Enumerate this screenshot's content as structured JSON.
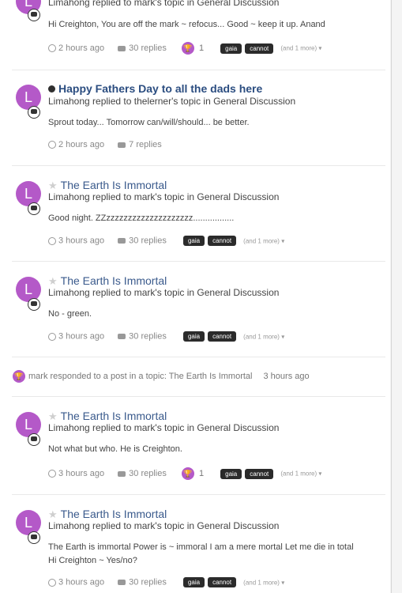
{
  "feed": {
    "item1": {
      "avatar_letter": "L",
      "subtitle": "Limahong replied to mark's topic in General Discussion",
      "body": "Hi Creighton, You are off the mark ~ refocus... Good ~ keep it up. Anand",
      "time": "2 hours ago",
      "replies": "30 replies",
      "trophy_count": "1",
      "tags": [
        "gaia",
        "cannot"
      ],
      "more": "(and 1 more)"
    },
    "item2": {
      "avatar_letter": "L",
      "title": "Happy Fathers Day to all the dads here",
      "subtitle": "Limahong replied to thelerner's topic in General Discussion",
      "body": "Sprout today... Tomorrow can/will/should... be better.",
      "time": "2 hours ago",
      "replies": "7 replies"
    },
    "item3": {
      "avatar_letter": "L",
      "title": "The Earth Is Immortal",
      "subtitle": "Limahong replied to mark's topic in General Discussion",
      "body": "Good night. ZZzzzzzzzzzzzzzzzzzzzz.................",
      "time": "3 hours ago",
      "replies": "30 replies",
      "tags": [
        "gaia",
        "cannot"
      ],
      "more": "(and 1 more)"
    },
    "item4": {
      "avatar_letter": "L",
      "title": "The Earth Is Immortal",
      "subtitle": "Limahong replied to mark's topic in General Discussion",
      "body": "No - green.",
      "time": "3 hours ago",
      "replies": "30 replies",
      "tags": [
        "gaia",
        "cannot"
      ],
      "more": "(and 1 more)"
    },
    "activity": {
      "text": "mark responded to a post in a topic: The Earth Is Immortal",
      "time": "3 hours ago"
    },
    "item5": {
      "avatar_letter": "L",
      "title": "The Earth Is Immortal",
      "subtitle": "Limahong replied to mark's topic in General Discussion",
      "body": "Not what but who. He is Creighton.",
      "time": "3 hours ago",
      "replies": "30 replies",
      "trophy_count": "1",
      "tags": [
        "gaia",
        "cannot"
      ],
      "more": "(and 1 more)"
    },
    "item6": {
      "avatar_letter": "L",
      "title": "The Earth Is Immortal",
      "subtitle": "Limahong replied to mark's topic in General Discussion",
      "body": "The Earth is immortal Power is ~ immoral I am a mere mortal Let me die in total Hi Creighton ~ Yes/no?",
      "time": "3 hours ago",
      "replies": "30 replies",
      "tags": [
        "gaia",
        "cannot"
      ],
      "more": "(and 1 more)"
    }
  },
  "colors": {
    "avatar": "#b459c8",
    "link": "#3a5a8c",
    "tag_bg": "#2b2b2b"
  },
  "icons": [
    "clock-icon",
    "comment-icon",
    "trophy-icon",
    "star-icon",
    "speech-bubble-icon",
    "caret-down-icon"
  ]
}
